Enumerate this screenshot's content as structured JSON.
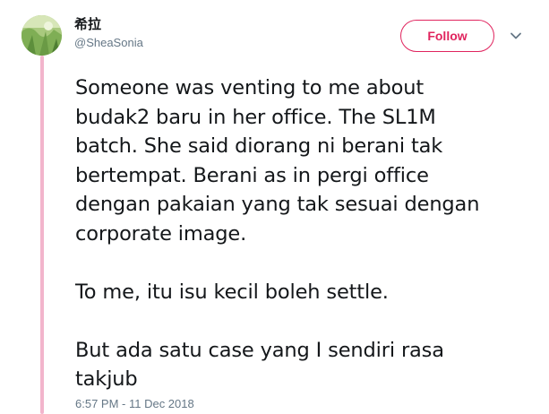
{
  "user": {
    "display_name": "希拉",
    "handle": "@SheaSonia"
  },
  "actions": {
    "follow_label": "Follow",
    "menu_icon": "chevron-down-icon"
  },
  "tweet": {
    "paragraphs": [
      {
        "lines": [
          "Someone was venting to me about",
          "budak2 baru in her office. The SL1M",
          "batch. She said diorang ni berani tak",
          "bertempat. Berani as in pergi office",
          "dengan pakaian yang tak sesuai dengan",
          "corporate image."
        ]
      },
      {
        "lines": [
          "To me, itu isu kecil boleh settle."
        ]
      },
      {
        "lines": [
          "But ada satu case yang I sendiri rasa",
          "takjub"
        ]
      }
    ],
    "timestamp": "6:57 PM - 11 Dec 2018"
  },
  "colors": {
    "accent": "#e0245e",
    "thread_line": "#f2b5cc",
    "secondary_text": "#657786",
    "primary_text": "#14171a"
  }
}
